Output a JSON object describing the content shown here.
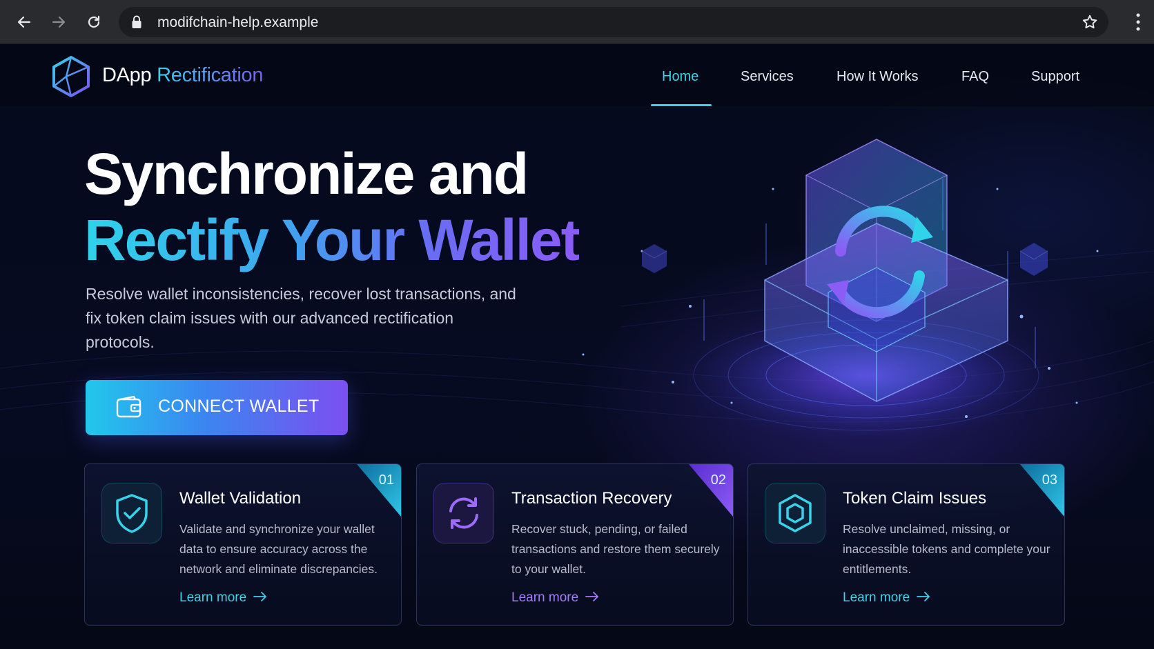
{
  "browser": {
    "url": "modifchain-help.example",
    "icons": [
      "back-arrow-icon",
      "forward-arrow-icon",
      "reload-icon",
      "lock-icon",
      "star-icon",
      "menu-dots-icon"
    ]
  },
  "header": {
    "brand_part1": "DApp",
    "brand_part2": "Rectification",
    "nav": [
      {
        "label": "Home",
        "active": true
      },
      {
        "label": "Services",
        "active": false
      },
      {
        "label": "How It Works",
        "active": false
      },
      {
        "label": "FAQ",
        "active": false
      },
      {
        "label": "Support",
        "active": false
      }
    ]
  },
  "hero": {
    "title_line1": "Synchronize and",
    "title_line2": "Rectify Your Wallet",
    "subtitle": "Resolve wallet inconsistencies, recover lost transactions, and fix token claim issues with our advanced rectification protocols.",
    "cta_label": "CONNECT WALLET"
  },
  "cards": [
    {
      "number": "01",
      "title": "Wallet Validation",
      "description": "Validate and synchronize your wallet data to ensure accuracy across the network and eliminate discrepancies.",
      "link": "Learn more",
      "icon": "shield-check-icon",
      "accent": "#2fc6e8"
    },
    {
      "number": "02",
      "title": "Transaction Recovery",
      "description": "Recover stuck, pending, or failed transactions and restore them securely to your wallet.",
      "link": "Learn more",
      "icon": "sync-icon",
      "accent": "#8b5cf6"
    },
    {
      "number": "03",
      "title": "Token Claim Issues",
      "description": "Resolve unclaimed, missing, or inaccessible tokens and complete your entitlements.",
      "link": "Learn more",
      "icon": "hexagon-icon",
      "accent": "#2fc6e8"
    }
  ],
  "colors": {
    "background": "#050816",
    "cyan": "#3fd2e6",
    "purple": "#8b5cf6"
  }
}
